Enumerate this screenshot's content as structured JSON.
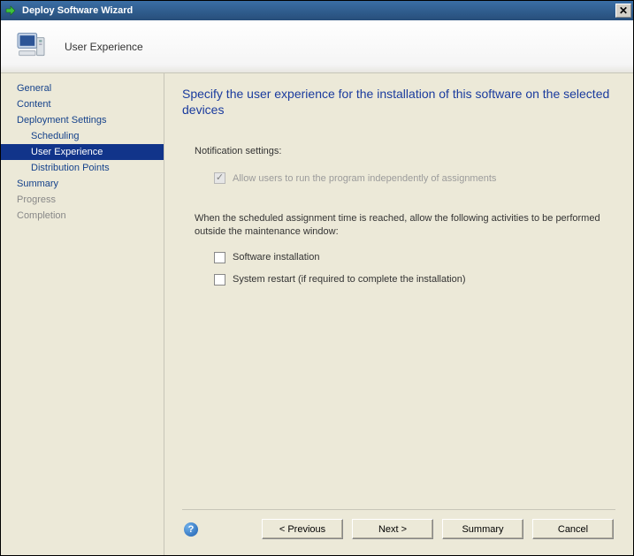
{
  "window": {
    "title": "Deploy Software Wizard"
  },
  "header": {
    "page_title": "User Experience"
  },
  "sidebar": {
    "items": [
      {
        "label": "General",
        "sub": false
      },
      {
        "label": "Content",
        "sub": false
      },
      {
        "label": "Deployment Settings",
        "sub": false
      },
      {
        "label": "Scheduling",
        "sub": true
      },
      {
        "label": "User Experience",
        "sub": true,
        "selected": true
      },
      {
        "label": "Distribution Points",
        "sub": true
      },
      {
        "label": "Summary",
        "sub": false
      },
      {
        "label": "Progress",
        "sub": false,
        "muted": true
      },
      {
        "label": "Completion",
        "sub": false,
        "muted": true
      }
    ]
  },
  "content": {
    "heading": "Specify the user experience for the installation of this software on the selected devices",
    "notification_label": "Notification settings:",
    "allow_users_label": "Allow users to run the program independently of assignments",
    "allow_users_checked": true,
    "allow_users_disabled": true,
    "maintenance_text": "When the scheduled assignment time is reached, allow the following activities to be performed outside the maintenance window:",
    "software_install_label": "Software installation",
    "software_install_checked": false,
    "system_restart_label": "System restart (if required to complete the installation)",
    "system_restart_checked": false
  },
  "footer": {
    "previous": "< Previous",
    "next": "Next >",
    "summary": "Summary",
    "cancel": "Cancel"
  }
}
